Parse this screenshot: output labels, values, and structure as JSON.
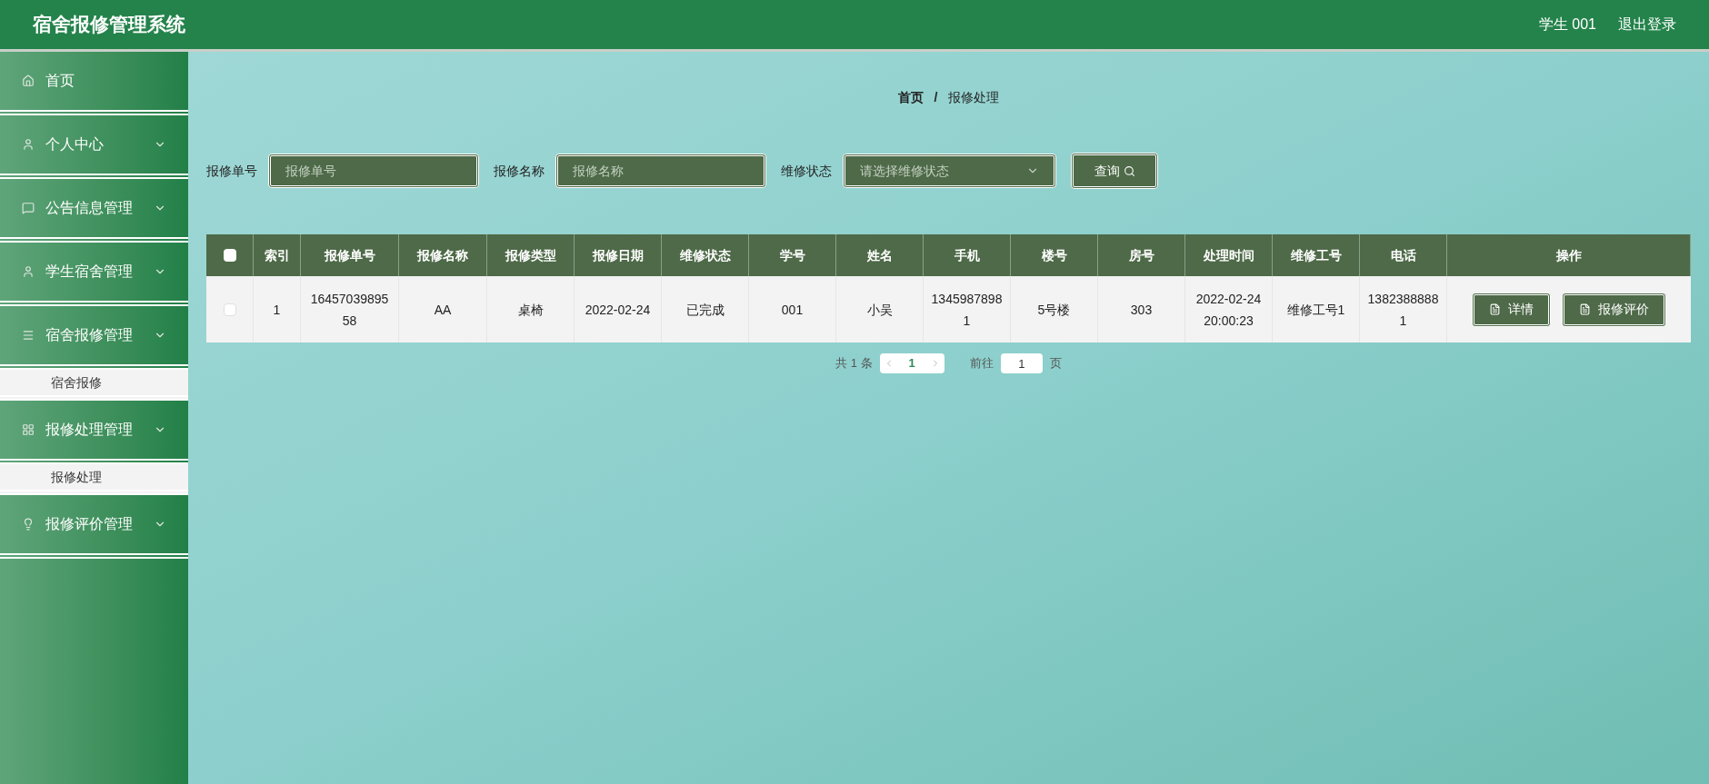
{
  "header": {
    "title": "宿舍报修管理系统",
    "user": "学生 001",
    "logout": "退出登录"
  },
  "sidebar": {
    "items": [
      {
        "label": "首页",
        "expandable": false
      },
      {
        "label": "个人中心",
        "expandable": true
      },
      {
        "label": "公告信息管理",
        "expandable": true
      },
      {
        "label": "学生宿舍管理",
        "expandable": true
      },
      {
        "label": "宿舍报修管理",
        "expandable": true,
        "children": [
          {
            "label": "宿舍报修"
          }
        ]
      },
      {
        "label": "报修处理管理",
        "expandable": true,
        "children": [
          {
            "label": "报修处理"
          }
        ]
      },
      {
        "label": "报修评价管理",
        "expandable": true
      }
    ]
  },
  "breadcrumb": [
    "首页",
    "报修处理"
  ],
  "breadcrumb_separator": "/",
  "search": {
    "fields": [
      {
        "label": "报修单号",
        "placeholder": "报修单号",
        "kind": "input"
      },
      {
        "label": "报修名称",
        "placeholder": "报修名称",
        "kind": "input"
      },
      {
        "label": "维修状态",
        "placeholder": "请选择维修状态",
        "kind": "select"
      }
    ],
    "button": "查询"
  },
  "table": {
    "select_all_checked": false,
    "columns": [
      "索引",
      "报修单号",
      "报修名称",
      "报修类型",
      "报修日期",
      "维修状态",
      "学号",
      "姓名",
      "手机",
      "楼号",
      "房号",
      "处理时间",
      "维修工号",
      "电话",
      "操作"
    ],
    "rows": [
      {
        "checked": false,
        "cells": [
          "1",
          "1645703989558",
          "AA",
          "桌椅",
          "2022-02-24",
          "已完成",
          "001",
          "小吴",
          "13459878981",
          "5号楼",
          "303",
          "2022-02-24 20:00:23",
          "维修工号1",
          "13823888881"
        ],
        "actions": [
          "详情",
          "报修评价"
        ]
      }
    ]
  },
  "pagination": {
    "total": "共 1 条",
    "pages": [
      {
        "label": "1",
        "selected": true
      }
    ],
    "goto_label": "前往",
    "goto_value": "1",
    "page_suffix": "页"
  }
}
